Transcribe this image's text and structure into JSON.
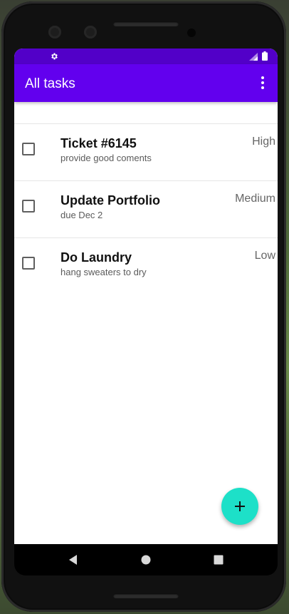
{
  "app": {
    "title": "All tasks"
  },
  "icons": {
    "status_left": "gear-icon",
    "status_right": [
      "signal-icon",
      "battery-icon"
    ],
    "menu": "more-vert-icon",
    "fab": "add-icon",
    "nav": [
      "back-icon",
      "home-icon",
      "recents-icon"
    ]
  },
  "tasks": [
    {
      "title": "Ticket #6145",
      "description": "provide good coments",
      "priority": "High",
      "checked": false
    },
    {
      "title": "Update Portfolio",
      "description": "due Dec 2",
      "priority": "Medium",
      "checked": false
    },
    {
      "title": "Do Laundry",
      "description": "hang sweaters to dry",
      "priority": "Low",
      "checked": false
    }
  ],
  "colors": {
    "status_bar": "#5200c8",
    "app_bar": "#6200ee",
    "fab": "#1de0c8"
  }
}
